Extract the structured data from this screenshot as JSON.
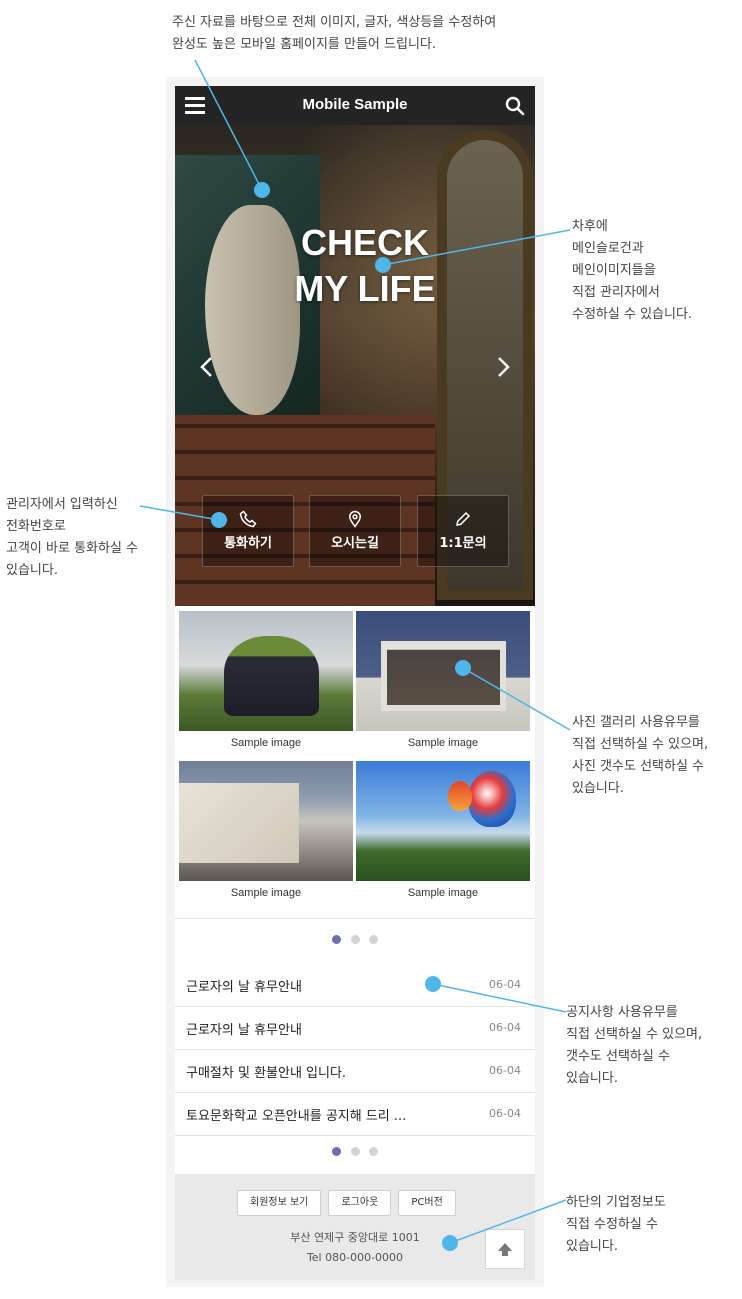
{
  "annotations": {
    "top": "주신 자료를 바탕으로 전체 이미지, 글자, 색상등을 수정하여\n완성도 높은 모바일 홈페이지를 만들어 드립니다.",
    "hero": "차후에\n메인슬로건과\n메인이미지들을\n직접 관리자에서\n수정하실 수 있습니다.",
    "call": "관리자에서 입력하신\n전화번호로\n고객이 바로 통화하실 수\n있습니다.",
    "gallery": "사진 갤러리 사용유무를\n직접 선택하실 수 있으며,\n사진 갯수도 선택하실 수\n있습니다.",
    "notice": "공지사항 사용유무를\n직접 선택하실 수 있으며,\n갯수도 선택하실 수\n있습니다.",
    "footer": "하단의 기업정보도\n직접 수정하실 수\n있습니다."
  },
  "header": {
    "title": "Mobile Sample",
    "menu_icon": "hamburger-menu-icon",
    "search_icon": "search-icon"
  },
  "hero": {
    "line1": "CHECK",
    "line2": "MY LIFE"
  },
  "quick_menu": [
    {
      "label": "통화하기",
      "icon": "phone-icon"
    },
    {
      "label": "오시는길",
      "icon": "location-pin-icon"
    },
    {
      "label": "1:1문의",
      "icon": "pencil-icon"
    }
  ],
  "gallery": [
    {
      "caption": "Sample image"
    },
    {
      "caption": "Sample image"
    },
    {
      "caption": "Sample image"
    },
    {
      "caption": "Sample image"
    }
  ],
  "notices": [
    {
      "title": "근로자의 날 휴무안내",
      "date": "06-04"
    },
    {
      "title": "근로자의 날 휴무안내",
      "date": "06-04"
    },
    {
      "title": "구매절차 및 환불안내 입니다.",
      "date": "06-04"
    },
    {
      "title": "토요문화학교 오픈안내를 공지해 드리 ...",
      "date": "06-04"
    }
  ],
  "footer": {
    "buttons": [
      "회원정보 보기",
      "로그아웃",
      "PC버전"
    ],
    "address": "부산 연제구 중앙대로 1001",
    "tel": "Tel 080-000-0000"
  },
  "colors": {
    "header_bg": "#242424",
    "accent_dot": "#6a6fb3",
    "callout": "#4fb6ea"
  }
}
